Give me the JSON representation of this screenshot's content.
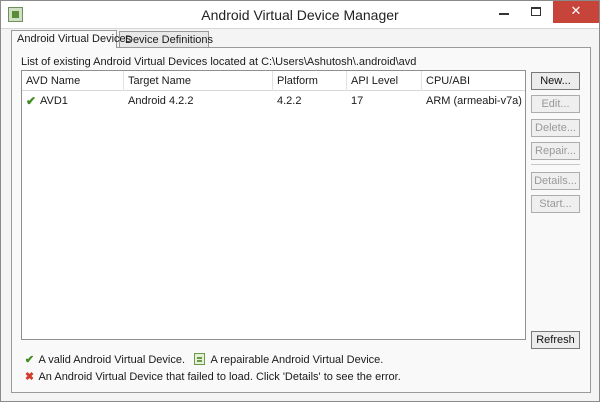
{
  "window": {
    "title": "Android Virtual Device Manager",
    "close_glyph": "✕"
  },
  "tabs": [
    {
      "label": "Android Virtual Devices"
    },
    {
      "label": "Device Definitions"
    }
  ],
  "location_text": "List of existing Android Virtual Devices located at C:\\Users\\Ashutosh\\.android\\avd",
  "table": {
    "columns": [
      "AVD Name",
      "Target Name",
      "Platform",
      "API Level",
      "CPU/ABI"
    ],
    "rows": [
      {
        "name": "AVD1",
        "target": "Android 4.2.2",
        "platform": "4.2.2",
        "api": "17",
        "abi": "ARM (armeabi-v7a)",
        "status_icon": "valid-check-icon"
      }
    ]
  },
  "buttons": {
    "new": "New...",
    "edit": "Edit...",
    "delete": "Delete...",
    "repair": "Repair...",
    "details": "Details...",
    "start": "Start...",
    "refresh": "Refresh"
  },
  "legend": {
    "valid": "A valid Android Virtual Device.",
    "repairable": "A repairable Android Virtual Device.",
    "failed": "An Android Virtual Device that failed to load. Click 'Details' to see the error."
  },
  "colors": {
    "valid_green": "#3c8c1c",
    "error_red": "#d23a2a",
    "close_red": "#c7443a"
  }
}
